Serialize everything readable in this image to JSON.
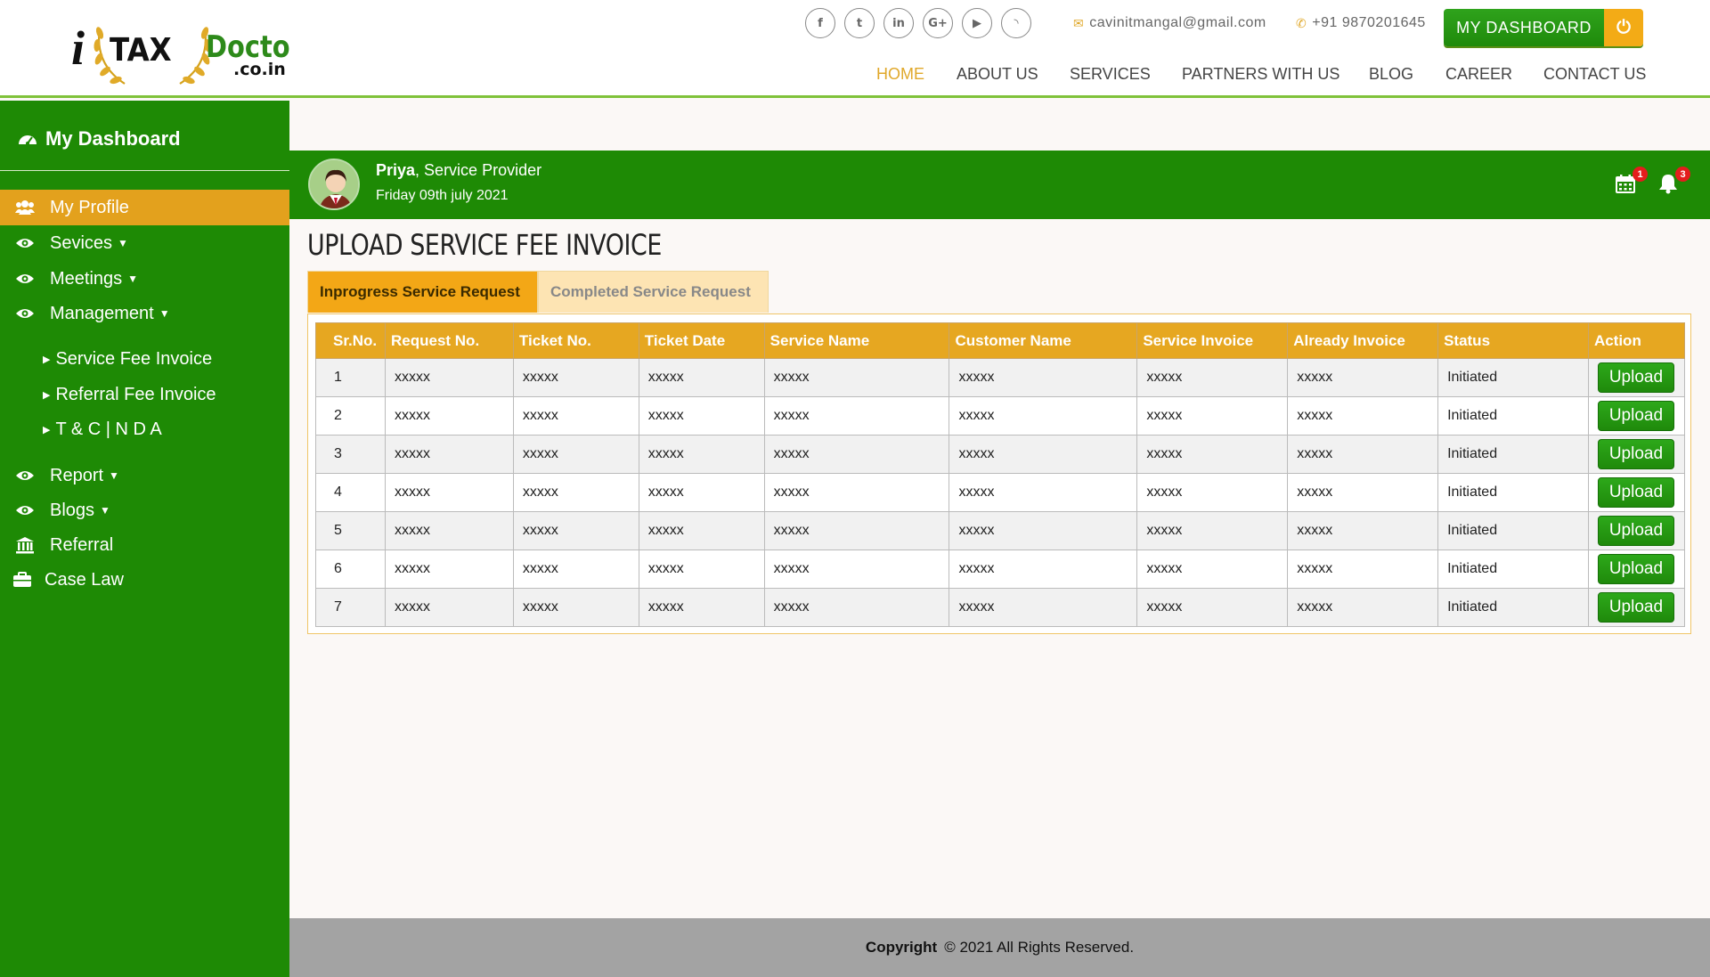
{
  "header": {
    "logo": {
      "i": "i",
      "tax": "TAX",
      "doctor": "Doctor",
      "domain": ".co.in"
    },
    "socials": [
      {
        "icon": "facebook-icon",
        "glyph": "f"
      },
      {
        "icon": "twitter-icon",
        "glyph": "t"
      },
      {
        "icon": "linkedin-icon",
        "glyph": "in"
      },
      {
        "icon": "google-plus-icon",
        "glyph": "G+"
      },
      {
        "icon": "youtube-icon",
        "glyph": "▶"
      },
      {
        "icon": "rss-icon",
        "glyph": "◝"
      }
    ],
    "email": "cavinitmangal@gmail.com",
    "phone": "+91 9870201645",
    "dashboard_button": "MY DASHBOARD",
    "nav": [
      "HOME",
      "ABOUT US",
      "SERVICES",
      "PARTNERS WITH US",
      "BLOG",
      "CAREER",
      "CONTACT US"
    ],
    "active_nav": "HOME"
  },
  "sidebar": {
    "title": "My Dashboard",
    "items": [
      {
        "label": "My Profile",
        "icon": "users-icon",
        "active": true,
        "caret": false
      },
      {
        "label": "Sevices",
        "icon": "eye-icon",
        "caret": true
      },
      {
        "label": "Meetings",
        "icon": "eye-icon",
        "caret": true
      },
      {
        "label": "Management",
        "icon": "eye-icon",
        "caret": true
      },
      {
        "label": "Report",
        "icon": "eye-icon",
        "caret": true
      },
      {
        "label": "Blogs",
        "icon": "eye-icon",
        "caret": true
      },
      {
        "label": "Referral",
        "icon": "bank-icon",
        "caret": false
      },
      {
        "label": "Case Law",
        "icon": "briefcase-icon",
        "caret": false
      }
    ],
    "sub_items": [
      "Service Fee Invoice",
      "Referral Fee Invoice",
      "T & C | N D A"
    ]
  },
  "profile": {
    "name": "Priya",
    "role": ", Service Provider",
    "date": "Friday 09th july 2021",
    "calendar_badge": "1",
    "bell_badge": "3"
  },
  "main": {
    "title": "UPLOAD SERVICE FEE INVOICE",
    "tabs": [
      "Inprogress Service Request",
      "Completed Service Request"
    ],
    "columns": [
      "Sr.No.",
      "Request No.",
      "Ticket No.",
      "Ticket Date",
      "Service Name",
      "Customer Name",
      "Service Invoice",
      "Already Invoice",
      "Status",
      "Action"
    ],
    "rows": [
      [
        "1",
        "xxxxx",
        "xxxxx",
        "xxxxx",
        "xxxxx",
        "xxxxx",
        "xxxxx",
        "xxxxx",
        "Initiated",
        "Upload"
      ],
      [
        "2",
        "xxxxx",
        "xxxxx",
        "xxxxx",
        "xxxxx",
        "xxxxx",
        "xxxxx",
        "xxxxx",
        "Initiated",
        "Upload"
      ],
      [
        "3",
        "xxxxx",
        "xxxxx",
        "xxxxx",
        "xxxxx",
        "xxxxx",
        "xxxxx",
        "xxxxx",
        "Initiated",
        "Upload"
      ],
      [
        "4",
        "xxxxx",
        "xxxxx",
        "xxxxx",
        "xxxxx",
        "xxxxx",
        "xxxxx",
        "xxxxx",
        "Initiated",
        "Upload"
      ],
      [
        "5",
        "xxxxx",
        "xxxxx",
        "xxxxx",
        "xxxxx",
        "xxxxx",
        "xxxxx",
        "xxxxx",
        "Initiated",
        "Upload"
      ],
      [
        "6",
        "xxxxx",
        "xxxxx",
        "xxxxx",
        "xxxxx",
        "xxxxx",
        "xxxxx",
        "xxxxx",
        "Initiated",
        "Upload"
      ],
      [
        "7",
        "xxxxx",
        "xxxxx",
        "xxxxx",
        "xxxxx",
        "xxxxx",
        "xxxxx",
        "xxxxx",
        "Initiated",
        "Upload"
      ]
    ]
  },
  "footer": {
    "copyright_label": "Copyright",
    "text": "© 2021 All Rights Reserved."
  },
  "colors": {
    "green": "#1e8a05",
    "gold": "#e3a11d",
    "tab_active": "#f3a716",
    "tab_inactive": "#fde4b3",
    "footer": "#a3a3a3"
  }
}
